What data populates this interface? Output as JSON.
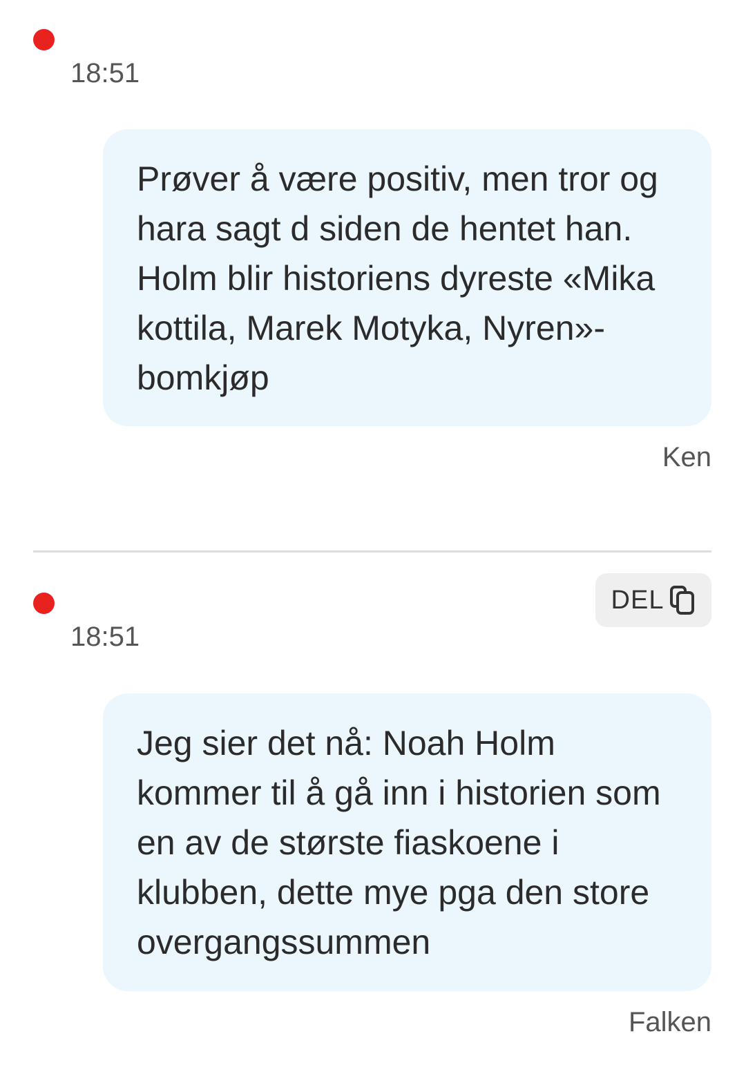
{
  "feed": {
    "posts": [
      {
        "time": "18:51",
        "text": "Prøver å være positiv, men tror og hara sagt d siden de hentet han. Holm blir historiens dyreste «Mika kottila, Marek Motyka, Nyren»-bomkjøp",
        "author": "Ken"
      },
      {
        "time": "18:51",
        "share_label": "DEL",
        "text": "Jeg sier det nå: Noah Holm kommer til å gå inn i historien som en av de største fiaskoene i klubben, dette mye pga den store overgangssummen",
        "author": "Falken"
      }
    ]
  },
  "colors": {
    "live_dot": "#e8231f",
    "bubble_background": "#ecf6fd",
    "share_button_background": "#efefef",
    "meta_text": "#555555"
  },
  "icons": {
    "live_indicator": "live-dot-icon",
    "share": "copy-icon"
  }
}
